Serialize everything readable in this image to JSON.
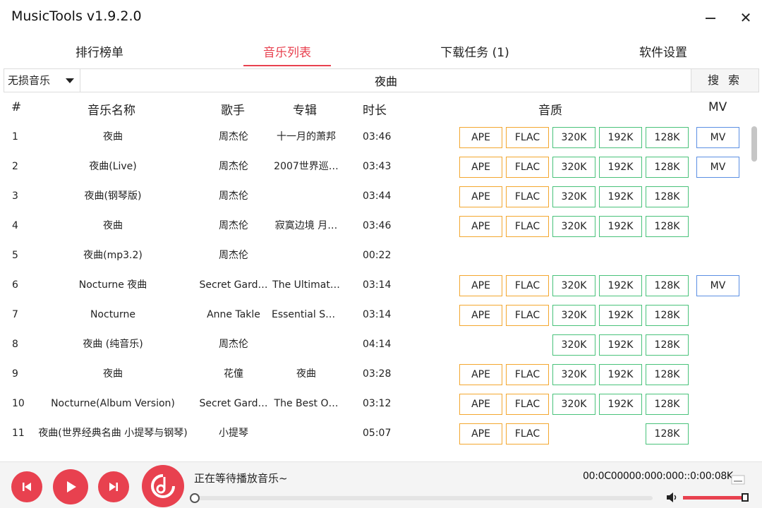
{
  "app": {
    "title": "MusicTools v1.9.2.0"
  },
  "window": {
    "minimize_icon": "minimize-icon",
    "close_label": "✕"
  },
  "tabs": [
    {
      "label": "排行榜单",
      "active": false
    },
    {
      "label": "音乐列表",
      "active": true
    },
    {
      "label": "下载任务 (1)",
      "active": false
    },
    {
      "label": "软件设置",
      "active": false
    }
  ],
  "search": {
    "type_selected": "无损音乐",
    "query": "夜曲",
    "button_label": "搜 索"
  },
  "table": {
    "headers": {
      "num": "#",
      "name": "音乐名称",
      "artist": "歌手",
      "album": "专辑",
      "duration": "时长",
      "quality": "音质",
      "mv": "MV"
    },
    "rows": [
      {
        "num": "1",
        "name": "夜曲",
        "artist": "周杰伦",
        "album": "十一月的萧邦",
        "duration": "03:46",
        "q": [
          "APE",
          "FLAC",
          "320K",
          "192K",
          "128K"
        ],
        "mv": "MV"
      },
      {
        "num": "2",
        "name": "夜曲(Live)",
        "artist": "周杰伦",
        "album": "2007世界巡…",
        "duration": "03:43",
        "q": [
          "APE",
          "FLAC",
          "320K",
          "192K",
          "128K"
        ],
        "mv": "MV"
      },
      {
        "num": "3",
        "name": "夜曲(钢琴版)",
        "artist": "周杰伦",
        "album": "",
        "duration": "03:44",
        "q": [
          "APE",
          "FLAC",
          "320K",
          "192K",
          "128K"
        ],
        "mv": ""
      },
      {
        "num": "4",
        "name": "夜曲",
        "artist": "周杰伦",
        "album": "寂寞边境 月…",
        "duration": "03:46",
        "q": [
          "APE",
          "FLAC",
          "320K",
          "192K",
          "128K"
        ],
        "mv": ""
      },
      {
        "num": "5",
        "name": "夜曲(mp3.2)",
        "artist": "周杰伦",
        "album": "",
        "duration": "00:22",
        "q": [],
        "mv": ""
      },
      {
        "num": "6",
        "name": "Nocturne 夜曲",
        "artist": "Secret Gard…",
        "album": "The Ultimat…",
        "duration": "03:14",
        "q": [
          "APE",
          "FLAC",
          "320K",
          "192K",
          "128K"
        ],
        "mv": "MV"
      },
      {
        "num": "7",
        "name": "Nocturne",
        "artist": "Anne Takle",
        "album": "Essential Se…",
        "duration": "03:14",
        "q": [
          "APE",
          "FLAC",
          "320K",
          "192K",
          "128K"
        ],
        "mv": ""
      },
      {
        "num": "8",
        "name": "夜曲 (纯音乐)",
        "artist": "周杰伦",
        "album": "",
        "duration": "04:14",
        "q": [
          "320K",
          "192K",
          "128K"
        ],
        "mv": ""
      },
      {
        "num": "9",
        "name": "夜曲",
        "artist": "花僮",
        "album": "夜曲",
        "duration": "03:28",
        "q": [
          "APE",
          "FLAC",
          "320K",
          "192K",
          "128K"
        ],
        "mv": ""
      },
      {
        "num": "10",
        "name": "Nocturne(Album Version)",
        "artist": "Secret Gard…",
        "album": "The Best O…",
        "duration": "03:12",
        "q": [
          "APE",
          "FLAC",
          "320K",
          "192K",
          "128K"
        ],
        "mv": ""
      },
      {
        "num": "11",
        "name": "夜曲(世界经典名曲 小提琴与钢琴)",
        "artist": "小提琴",
        "album": "",
        "duration": "05:07",
        "q": [
          "APE",
          "FLAC",
          "128K"
        ],
        "mv": ""
      }
    ]
  },
  "player": {
    "status": "正在等待播放音乐~",
    "time": "00:0C00000:000:000::0:00:08K",
    "progress": 0.0,
    "volume": 1.0,
    "colors": {
      "accent": "#e8414f",
      "ape_flac": "#f3a72f",
      "kbps": "#49c27a",
      "mv": "#5b8fe3"
    }
  }
}
